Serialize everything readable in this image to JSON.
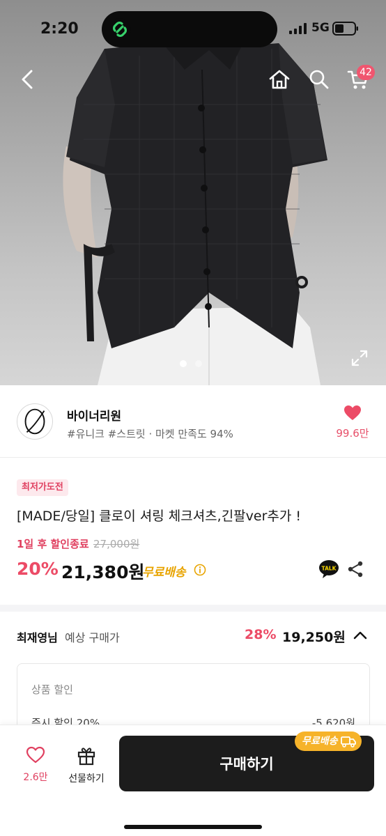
{
  "status_bar": {
    "time": "2:20",
    "network": "5G"
  },
  "nav": {
    "cart_count": "42"
  },
  "gallery": {
    "page_count": 2,
    "active_index": 0
  },
  "store": {
    "name": "바이너리원",
    "tags": "#유니크 #스트릿 · 마켓 만족도 94%",
    "likes": "99.6만"
  },
  "product": {
    "badge": "최저가도전",
    "title": "[MADE/당일] 클로이 셔링 체크셔츠,긴팔ver추가 !",
    "sale_end": "1일 후 할인종료",
    "original_price": "27,000원",
    "discount": "20%",
    "price": "21,380원",
    "free_shipping": "무료배송"
  },
  "estimate": {
    "user": "최재영님",
    "label": "예상 구매가",
    "discount": "28%",
    "price": "19,250원",
    "breakdown_title": "상품 할인",
    "items": [
      {
        "label": "즉시 할인 20%",
        "amount": "-5,620원"
      }
    ]
  },
  "bottom_bar": {
    "wish_count": "2.6만",
    "gift_label": "선물하기",
    "buy_label": "구매하기",
    "shipping_pill": "무료배송"
  },
  "colors": {
    "accent": "#ec4b66",
    "shipping": "#f6b32a",
    "buy_button": "#1c1c1c"
  }
}
